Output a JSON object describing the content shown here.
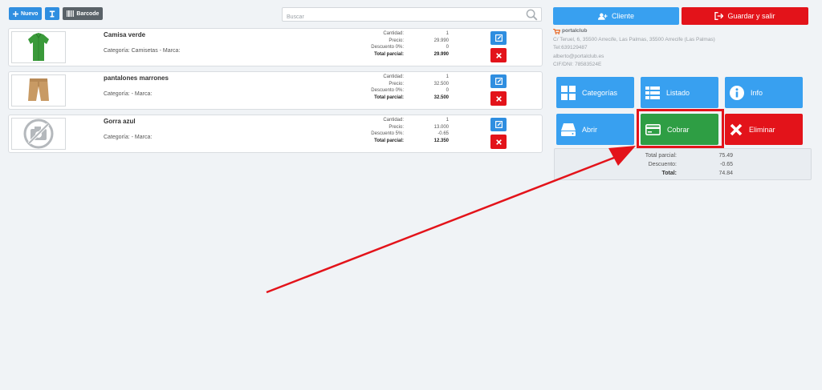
{
  "toolbar": {
    "nuevo_label": "Nuevo",
    "barcode_label": "Barcode"
  },
  "search": {
    "placeholder": "Buscar"
  },
  "lines": [
    {
      "name": "Camisa verde",
      "category": "Categoría: Camisetas - Marca:",
      "rows": [
        {
          "label": "Cantidad:",
          "value": "1"
        },
        {
          "label": "Precio:",
          "value": "29.990"
        },
        {
          "label": "Descuento 0%:",
          "value": "0"
        },
        {
          "label": "Total parcial:",
          "value": "29.990"
        }
      ]
    },
    {
      "name": "pantalones marrones",
      "category": "Categoría: - Marca:",
      "rows": [
        {
          "label": "Cantidad:",
          "value": "1"
        },
        {
          "label": "Precio:",
          "value": "32.500"
        },
        {
          "label": "Descuento 0%:",
          "value": "0"
        },
        {
          "label": "Total parcial:",
          "value": "32.500"
        }
      ]
    },
    {
      "name": "Gorra azul",
      "category": "Categoría: - Marca:",
      "rows": [
        {
          "label": "Cantidad:",
          "value": "1"
        },
        {
          "label": "Precio:",
          "value": "13.000"
        },
        {
          "label": "Descuento 5%:",
          "value": "-0.65"
        },
        {
          "label": "Total parcial:",
          "value": "12.350"
        }
      ]
    }
  ],
  "header": {
    "cliente_label": "Cliente",
    "guardar_label": "Guardar y salir"
  },
  "company": {
    "name": "portalclub",
    "address": "C/ Teruel, 6, 35500 Arrecife, Las Palmas, 35500 Arrecife (Las Palmas)",
    "phone": "Tel:639129487",
    "email": "alberto@portalclub.es",
    "cif": "CIF/DNI: 78583524E"
  },
  "actions": {
    "categorias": "Categorías",
    "listado": "Listado",
    "info": "Info",
    "abrir": "Abrir",
    "cobrar": "Cobrar",
    "eliminar": "Eliminar"
  },
  "totals": [
    {
      "label": "Total parcial:",
      "value": "75.49"
    },
    {
      "label": "Descuento:",
      "value": "-0.65"
    },
    {
      "label": "Total:",
      "value": "74.84"
    }
  ],
  "colors": {
    "primary": "#38a0f0",
    "danger": "#e3131a",
    "success": "#2e9e44",
    "annotation": "#e3131a"
  },
  "icons": [
    "plus-icon",
    "text-cursor-icon",
    "barcode-icon",
    "search-icon",
    "edit-icon",
    "delete-x-icon",
    "user-plus-icon",
    "logout-icon",
    "cart-icon",
    "grid-icon",
    "list-icon",
    "info-icon",
    "drive-icon",
    "card-icon",
    "close-x-icon",
    "camera-off-icon"
  ]
}
